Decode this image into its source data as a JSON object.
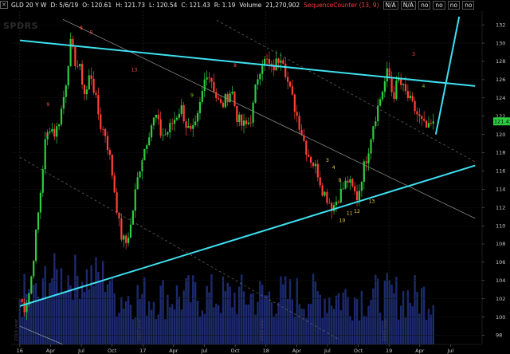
{
  "header": {
    "symbol": "GLD 20 Y W",
    "date": "D: 5/6/19",
    "open": "O: 120.61",
    "high": "H: 121.73",
    "low": "L: 120.54",
    "close": "C: 121.43",
    "change": "R: 1.19",
    "volume_label": "Volume",
    "volume_value": "21,270,902",
    "indicator_name": "SequenceCounter (13, 9)",
    "indicator_values": [
      "N/A",
      "N/A",
      "no",
      "no",
      "no",
      "no"
    ]
  },
  "watermark": "SPDRS",
  "last_price_tag": "121.43",
  "x_axis_labels": [
    "16",
    "Apr",
    "Jul",
    "Oct",
    "17",
    "Apr",
    "Jul",
    "Oct",
    "18",
    "Apr",
    "Jul",
    "Oct",
    "19",
    "Apr",
    "Jul"
  ],
  "y_axis_labels": [
    "132",
    "130",
    "128",
    "126",
    "124",
    "122",
    "120",
    "118",
    "116",
    "114",
    "112",
    "110",
    "108",
    "106",
    "104",
    "102",
    "100",
    "98"
  ],
  "year_markers": [
    "2016 year",
    "2017 year",
    "2018 year",
    "2019 year"
  ],
  "colors": {
    "background": "#000000",
    "up_candle": "#2ecc40",
    "down_candle": "#ff4136",
    "trendline": "#3ee0f0",
    "volume": "#1c2a6e",
    "last_tag": "#2ecc40"
  },
  "chart_data": {
    "type": "line",
    "title": "",
    "xlabel": "",
    "ylabel": "",
    "ylim": [
      97,
      133.5
    ],
    "x_ticks": [
      "16",
      "Apr",
      "Jul",
      "Oct",
      "17",
      "Apr",
      "Jul",
      "Oct",
      "18",
      "Apr",
      "Jul",
      "Oct",
      "19",
      "Apr",
      "Jul"
    ],
    "series": [
      {
        "values": [
          102,
          101,
          103,
          108,
          113,
          119,
          121,
          120,
          122,
          125,
          130,
          128,
          127,
          124,
          127,
          124,
          121,
          120,
          117,
          113,
          109,
          108,
          110,
          114,
          117,
          119,
          121,
          122,
          120,
          120,
          121,
          122,
          123,
          121,
          120,
          121,
          124,
          127,
          126,
          124,
          123,
          124,
          125,
          122,
          121,
          121,
          122,
          126,
          128,
          128,
          127,
          128,
          129,
          126,
          124,
          122,
          120,
          118,
          117,
          116,
          114,
          113,
          112,
          113,
          114,
          115,
          114,
          113,
          116,
          118,
          121,
          123,
          125,
          127,
          124,
          126,
          125,
          124,
          123,
          122,
          121,
          120.5,
          121.43
        ]
      }
    ],
    "trendlines": [
      {
        "name": "upper",
        "from": [
          2016.0,
          130.3
        ],
        "to": [
          2019.7,
          125.3
        ]
      },
      {
        "name": "lower",
        "from": [
          2016.0,
          101.2
        ],
        "to": [
          2019.7,
          116.6
        ]
      },
      {
        "name": "projection",
        "from": [
          2019.38,
          120.0
        ],
        "to": [
          2019.57,
          132.9
        ]
      }
    ],
    "sequence_counts": [
      {
        "label": "1",
        "x": 2016.22,
        "y": 119.8,
        "kind": "r"
      },
      {
        "label": "9",
        "x": 2016.23,
        "y": 123.1,
        "kind": "r"
      },
      {
        "label": "8",
        "x": 2016.5,
        "y": 131.5,
        "kind": "r"
      },
      {
        "label": "9",
        "x": 2016.58,
        "y": 131.0,
        "kind": "r"
      },
      {
        "label": "13",
        "x": 2016.93,
        "y": 126.9,
        "kind": "r"
      },
      {
        "label": "9",
        "x": 2017.4,
        "y": 124.1,
        "kind": "g"
      },
      {
        "label": "8",
        "x": 2017.75,
        "y": 127.4,
        "kind": "r"
      },
      {
        "label": "3",
        "x": 2018.5,
        "y": 117.0,
        "kind": "y"
      },
      {
        "label": "4",
        "x": 2018.55,
        "y": 116.2,
        "kind": "y"
      },
      {
        "label": "9",
        "x": 2018.6,
        "y": 114.8,
        "kind": "y"
      },
      {
        "label": "10",
        "x": 2018.62,
        "y": 110.4,
        "kind": "y"
      },
      {
        "label": "11",
        "x": 2018.68,
        "y": 111.2,
        "kind": "y"
      },
      {
        "label": "12",
        "x": 2018.74,
        "y": 111.4,
        "kind": "y"
      },
      {
        "label": "13",
        "x": 2018.86,
        "y": 112.5,
        "kind": "y"
      },
      {
        "label": "3",
        "x": 2019.2,
        "y": 128.6,
        "kind": "r"
      },
      {
        "label": "4",
        "x": 2019.28,
        "y": 125.1,
        "kind": "g"
      }
    ]
  }
}
